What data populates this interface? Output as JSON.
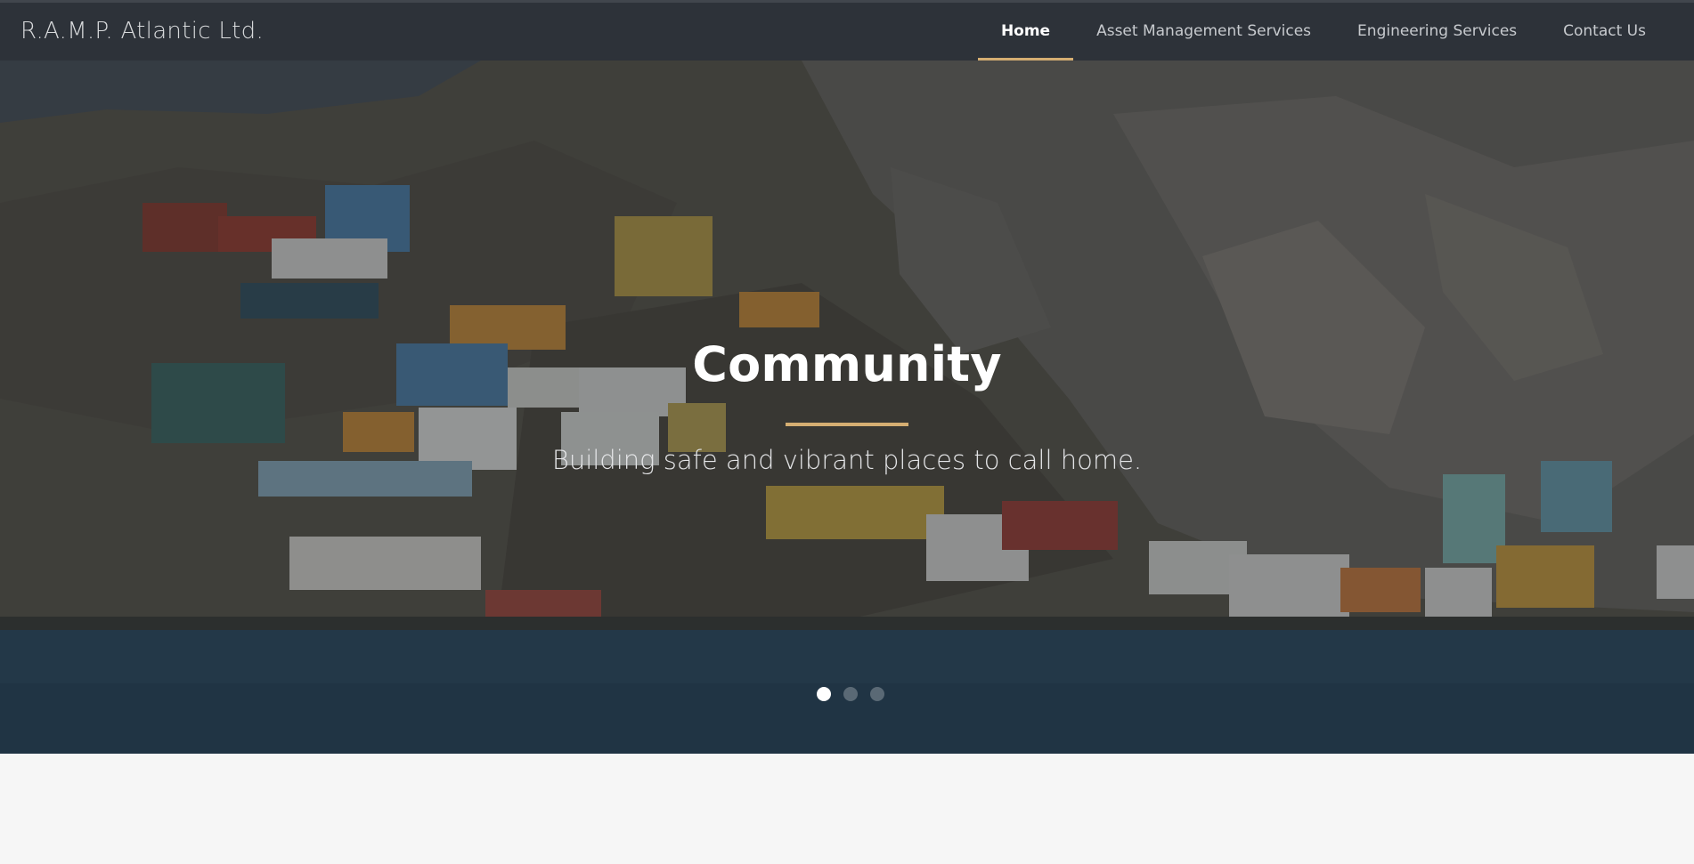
{
  "brand": "R.A.M.P. Atlantic Ltd.",
  "nav": {
    "items": [
      {
        "label": "Home",
        "active": true
      },
      {
        "label": "Asset Management Services",
        "active": false
      },
      {
        "label": "Engineering Services",
        "active": false
      },
      {
        "label": "Contact Us",
        "active": false
      }
    ]
  },
  "hero": {
    "title": "Community",
    "subtitle": "Building safe and vibrant places to call home.",
    "slide_count": 3,
    "active_slide": 1
  },
  "colors": {
    "navbar": "#2d3239",
    "accent": "#d5ae72"
  }
}
